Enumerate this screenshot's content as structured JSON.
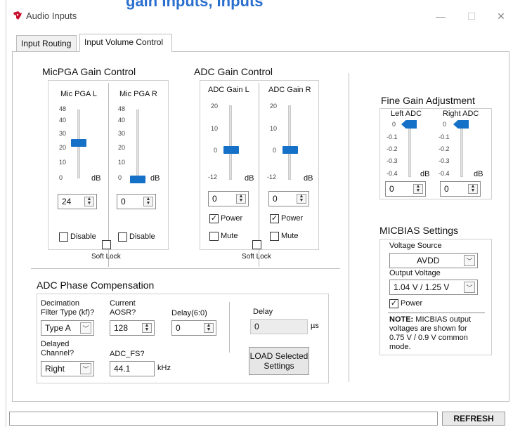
{
  "window": {
    "title": "Audio Inputs",
    "banner": "gain Inputs, Inputs"
  },
  "titlebar": {
    "minimize": "—",
    "maximize": "☐",
    "close": "✕"
  },
  "tabs": [
    {
      "label": "Input Routing"
    },
    {
      "label": "Input Volume Control"
    }
  ],
  "mic": {
    "header": "MicPGA Gain Control",
    "left": {
      "label": "Mic PGA L",
      "value": "24",
      "disable": "Disable",
      "level": 24
    },
    "right": {
      "label": "Mic PGA R",
      "value": "0",
      "disable": "Disable",
      "level": 0
    },
    "ticks": [
      "48",
      "40",
      "30",
      "20",
      "10",
      "0"
    ],
    "unit": "dB",
    "soft_lock": "Soft Lock"
  },
  "adc": {
    "header": "ADC Gain Control",
    "left": {
      "label": "ADC Gain L",
      "value": "0",
      "power": "Power",
      "mute": "Mute",
      "level": 0
    },
    "right": {
      "label": "ADC Gain R",
      "value": "0",
      "power": "Power",
      "mute": "Mute",
      "level": 0
    },
    "ticks": [
      "20",
      "10",
      "0",
      "-12"
    ],
    "unit": "dB",
    "soft_lock": "Soft Lock"
  },
  "fine": {
    "header": "Fine Gain Adjustment",
    "left": {
      "label": "Left ADC",
      "value": "0",
      "level": 0
    },
    "right": {
      "label": "Right ADC",
      "value": "0",
      "level": 0
    },
    "ticks": [
      "0",
      "-0.1",
      "-0.2",
      "-0.3",
      "-0.4"
    ],
    "unit": "dB"
  },
  "micbias": {
    "header": "MICBIAS Settings",
    "voltage_source_label": "Voltage Source",
    "voltage_source": "AVDD",
    "output_voltage_label": "Output Voltage",
    "output_voltage": "1.04 V / 1.25 V",
    "power": "Power",
    "note_bold": "NOTE:",
    "note_1": " MICBIAS output",
    "note_2": "voltages are shown for",
    "note_3": "0.75 V / 0.9 V common",
    "note_4": "mode."
  },
  "phase": {
    "header": "ADC Phase Compensation",
    "decimation_label_1": "Decimation",
    "decimation_label_2": "Filter Type (kf)?",
    "decimation_value": "Type A",
    "aosr_label_1": "Current",
    "aosr_label_2": "AOSR?",
    "aosr_value": "128",
    "delay60_label": "Delay(6:0)",
    "delay60_value": "0",
    "delay_label": "Delay",
    "delay_value": "0",
    "delay_unit": "µs",
    "channel_label_1": "Delayed",
    "channel_label_2": "Channel?",
    "channel_value": "Right",
    "adcfs_label": "ADC_FS?",
    "adcfs_value": "44.1",
    "adcfs_unit": "kHz",
    "load_1": "LOAD Selected",
    "load_2": "Settings"
  },
  "statusbar": {
    "refresh": "REFRESH"
  }
}
